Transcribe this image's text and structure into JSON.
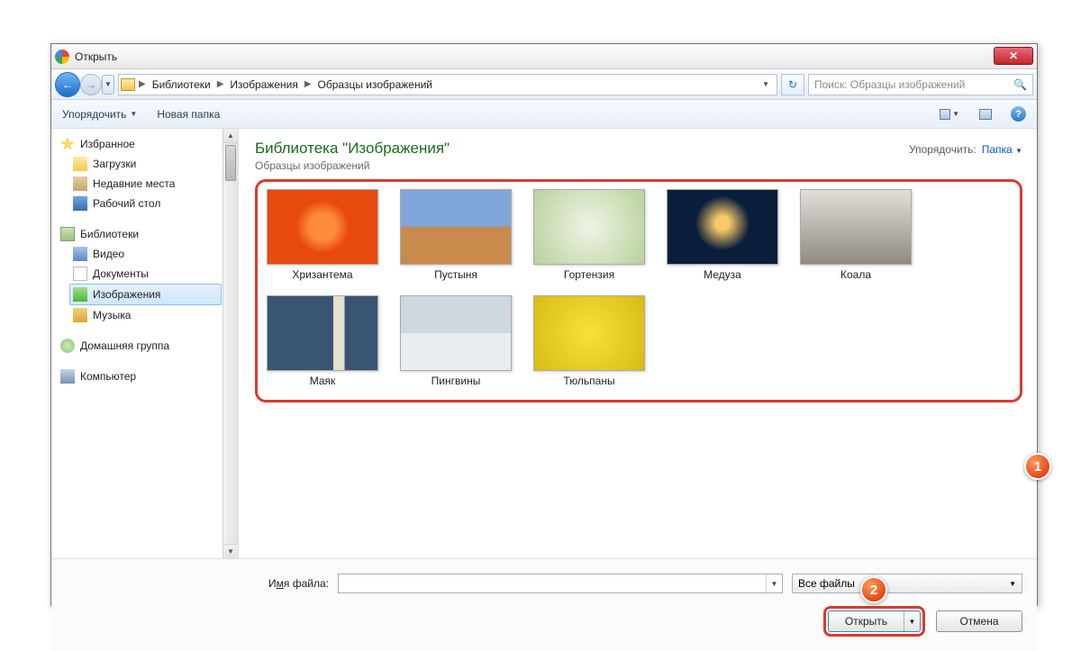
{
  "titlebar": {
    "title": "Открыть"
  },
  "breadcrumbs": [
    "Библиотеки",
    "Изображения",
    "Образцы изображений"
  ],
  "search": {
    "placeholder": "Поиск: Образцы изображений"
  },
  "toolbar": {
    "organize": "Упорядочить",
    "new_folder": "Новая папка"
  },
  "sidebar": {
    "favorites": "Избранное",
    "downloads": "Загрузки",
    "recent": "Недавние места",
    "desktop": "Рабочий стол",
    "libraries": "Библиотеки",
    "video": "Видео",
    "documents": "Документы",
    "images": "Изображения",
    "music": "Музыка",
    "homegroup": "Домашняя группа",
    "computer": "Компьютер"
  },
  "content": {
    "title": "Библиотека \"Изображения\"",
    "subtitle": "Образцы изображений",
    "sort_label": "Упорядочить:",
    "sort_value": "Папка"
  },
  "thumbs": {
    "chrysanthemum": "Хризантема",
    "desert": "Пустыня",
    "hydrangea": "Гортензия",
    "jellyfish": "Медуза",
    "koala": "Коала",
    "lighthouse": "Маяк",
    "penguins": "Пингвины",
    "tulips": "Тюльпаны"
  },
  "footer": {
    "filename_label_pre": "И",
    "filename_label_u": "м",
    "filename_label_post": "я файла:",
    "filetype": "Все файлы",
    "open": "Открыть",
    "cancel": "Отмена"
  },
  "markers": {
    "one": "1",
    "two": "2"
  }
}
